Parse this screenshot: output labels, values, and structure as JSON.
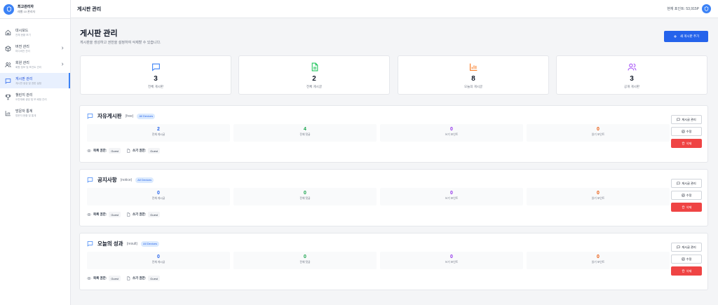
{
  "profile": {
    "name": "최고관리자",
    "subtitle": "레벨 10 관리자"
  },
  "nav": {
    "items": [
      {
        "label": "대시보드",
        "sub": "전체 현황 보기",
        "active": false,
        "chevron": false
      },
      {
        "label": "버전 관리",
        "sub": "미디버전 관리",
        "active": false,
        "chevron": true
      },
      {
        "label": "회원 관리",
        "sub": "회원 정보 및 포인트 관리",
        "active": false,
        "chevron": true
      },
      {
        "label": "게시판 관리",
        "sub": "게시판 생성 및 권한 설정",
        "active": true,
        "chevron": false
      },
      {
        "label": "챌린지 관리",
        "sub": "오잔재배 생성 및 보 배정 관리",
        "active": false,
        "chevron": false
      },
      {
        "label": "방문자 통계",
        "sub": "방문자 현황 및 통계",
        "active": false,
        "chevron": false
      }
    ]
  },
  "header": {
    "title": "게시판 관리",
    "points": "현재 포인트: 53,915P"
  },
  "page": {
    "title": "게시판 관리",
    "description": "게시판을 생성하고 권한을 설정하여 삭제할 수 있습니다.",
    "new_button": "새 게시판 추가"
  },
  "stats": [
    {
      "value": "3",
      "label": "전체 게시판",
      "color": "#3b82f6",
      "icon": "message-square-icon"
    },
    {
      "value": "2",
      "label": "전체 게시글",
      "color": "#22c55e",
      "icon": "file-text-icon"
    },
    {
      "value": "8",
      "label": "오늘의 게시글",
      "color": "#f97316",
      "icon": "bar-chart-icon"
    },
    {
      "value": "3",
      "label": "공개 게시판",
      "color": "#a855f7",
      "icon": "users-icon"
    }
  ],
  "boards": [
    {
      "name": "자유게시판",
      "slug": "(free)",
      "badge": "All Devices",
      "metrics": [
        {
          "value": "2",
          "label": "전체 게시글"
        },
        {
          "value": "4",
          "label": "전체 댓글"
        },
        {
          "value": "0",
          "label": "쓰기 포인트"
        },
        {
          "value": "0",
          "label": "읽기 포인트"
        }
      ],
      "read_label": "목록 권한:",
      "read_value": "Guest",
      "write_label": "쓰기 권한:",
      "write_value": "Guest"
    },
    {
      "name": "공지사항",
      "slug": "(notice)",
      "badge": "All Devices",
      "metrics": [
        {
          "value": "0",
          "label": "전체 게시글"
        },
        {
          "value": "0",
          "label": "전체 댓글"
        },
        {
          "value": "0",
          "label": "쓰기 포인트"
        },
        {
          "value": "0",
          "label": "읽기 포인트"
        }
      ],
      "read_label": "목록 권한:",
      "read_value": "Guest",
      "write_label": "쓰기 권한:",
      "write_value": "Guest"
    },
    {
      "name": "오늘의 성과",
      "slug": "(result)",
      "badge": "All Devices",
      "metrics": [
        {
          "value": "0",
          "label": "전체 게시글"
        },
        {
          "value": "0",
          "label": "전체 댓글"
        },
        {
          "value": "0",
          "label": "쓰기 포인트"
        },
        {
          "value": "0",
          "label": "읽기 포인트"
        }
      ],
      "read_label": "목록 권한:",
      "read_value": "Guest",
      "write_label": "쓰기 권한:",
      "write_value": "Guest"
    }
  ],
  "board_actions": {
    "manage": "게시글 관리",
    "edit": "수정",
    "delete": "삭제"
  },
  "metric_colors": [
    "#2563eb",
    "#16a34a",
    "#9333ea",
    "#ea580c"
  ]
}
